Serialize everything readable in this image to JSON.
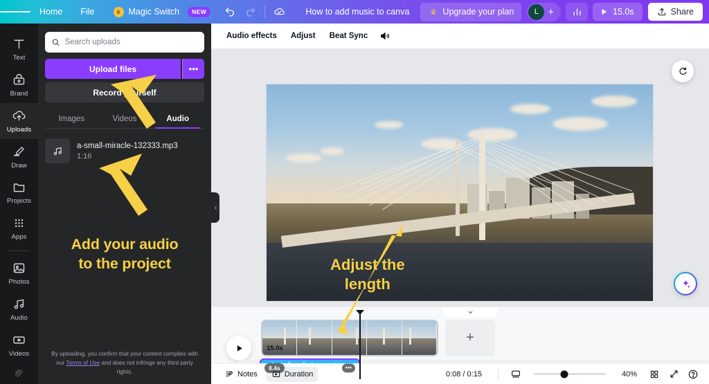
{
  "header": {
    "menu_icon": "hamburger-icon",
    "items": [
      {
        "label": "Home",
        "name": "home"
      },
      {
        "label": "File",
        "name": "file"
      },
      {
        "label": "Magic Switch",
        "name": "magic-switch",
        "badge": "NEW",
        "icon": "crown-icon"
      }
    ],
    "undo_icon": "undo-icon",
    "redo_icon": "redo-icon",
    "cloud_icon": "cloud-saved-icon",
    "doc_title": "How to add music to canva",
    "upgrade_label": "Upgrade your plan",
    "upgrade_icon": "crown-icon",
    "avatar_initial": "L",
    "add_member_icon": "plus-icon",
    "insights_icon": "insights-bar-chart-icon",
    "play_label": "15.0s",
    "play_icon": "play-icon",
    "share_label": "Share",
    "share_icon": "share-upload-icon"
  },
  "rail": {
    "items": [
      {
        "label": "Text",
        "icon": "text-icon",
        "active": false
      },
      {
        "label": "Brand",
        "icon": "brand-icon",
        "active": false
      },
      {
        "label": "Uploads",
        "icon": "uploads-cloud-icon",
        "active": true
      },
      {
        "label": "Draw",
        "icon": "draw-pen-icon",
        "active": false
      },
      {
        "label": "Projects",
        "icon": "projects-folder-icon",
        "active": false
      },
      {
        "label": "Apps",
        "icon": "apps-grid-icon",
        "active": false
      },
      {
        "label": "Photos",
        "icon": "photos-image-icon",
        "active": false
      },
      {
        "label": "Audio",
        "icon": "audio-note-icon",
        "active": false
      },
      {
        "label": "Videos",
        "icon": "videos-play-icon",
        "active": false
      }
    ]
  },
  "panel": {
    "search_placeholder": "Search uploads",
    "search_value": "",
    "search_icon": "search-icon",
    "upload_button": "Upload files",
    "upload_more_icon": "ellipsis-icon",
    "record_button": "Record yourself",
    "tabs": [
      {
        "label": "Images",
        "active": false
      },
      {
        "label": "Videos",
        "active": false
      },
      {
        "label": "Audio",
        "active": true
      }
    ],
    "uploads": [
      {
        "name": "a-small-miracle-132333.mp3",
        "duration": "1:16",
        "icon": "music-note-icon"
      }
    ],
    "annotation": "Add your audio\nto the project",
    "annotation_line1": "Add your audio",
    "annotation_line2": "to the project",
    "terms_prefix": "By uploading, you confirm that your content complies with our ",
    "terms_link": "Terms of Use",
    "terms_suffix": " and does not infringe any third party rights.",
    "collapse_icon": "chevron-left-icon"
  },
  "context_bar": {
    "items": [
      {
        "label": "Audio effects"
      },
      {
        "label": "Adjust"
      },
      {
        "label": "Beat Sync"
      }
    ],
    "volume_icon": "volume-speaker-icon"
  },
  "canvas": {
    "rotate_icon": "rotate-refresh-icon",
    "magic_icon": "magic-sparkle-icon",
    "annotation_line1": "Adjust the",
    "annotation_line2": "length",
    "image_description": "Aerial photo of a cable-stayed bridge over a river at golden hour with city skyline"
  },
  "timeline": {
    "play_icon": "play-icon",
    "page_duration": "15.0s",
    "add_page_icon": "plus-icon",
    "collapse_icon": "chevron-down-icon",
    "audio_clip_duration": "8.4s",
    "audio_clip_menu_icon": "ellipsis-icon"
  },
  "bottom_bar": {
    "notes_label": "Notes",
    "notes_icon": "notes-icon",
    "duration_label": "Duration",
    "duration_icon": "duration-icon",
    "time_display": "0:08 / 0:15",
    "pages_icon": "page-view-icon",
    "zoom_value": "40%",
    "grid_icon": "grid-view-icon",
    "fullscreen_icon": "fullscreen-icon",
    "help_icon": "help-question-icon"
  },
  "colors": {
    "brand_purple": "#8b3dff",
    "brand_teal": "#00c4cc",
    "annotation_yellow": "#f6d046",
    "audio_clip_blue": "#2fb4ff",
    "panel_dark": "#252627",
    "rail_dark": "#18191b"
  }
}
